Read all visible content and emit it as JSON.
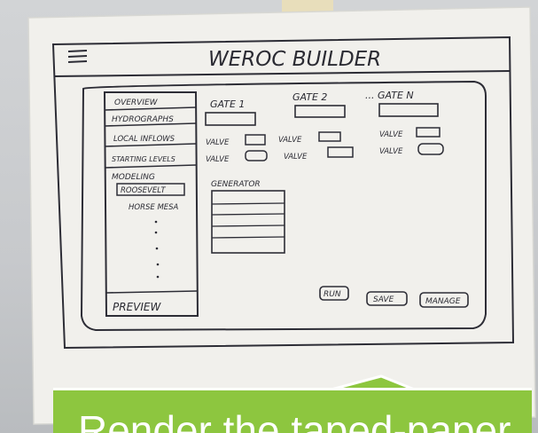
{
  "sketch": {
    "title": "WEROC BUILDER",
    "sidebar": {
      "items": [
        "OVERVIEW",
        "HYDROGRAPHS",
        "LOCAL INFLOWS",
        "STARTING LEVELS",
        "MODELING"
      ],
      "sub_items": [
        "ROOSEVELT",
        "HORSE MESA"
      ],
      "footer": "PREVIEW"
    },
    "gates": [
      "GATE 1",
      "GATE 2",
      "... GATE N"
    ],
    "valves": [
      "VALVE",
      "VALVE",
      "VALVE",
      "VALVE",
      "VALVE",
      "VALVE"
    ],
    "generator_label": "GENERATOR",
    "buttons": [
      "RUN",
      "SAVE",
      "MANAGE"
    ]
  },
  "callout": {
    "text": "Render the taped-paper",
    "color": "#8dc63f"
  }
}
